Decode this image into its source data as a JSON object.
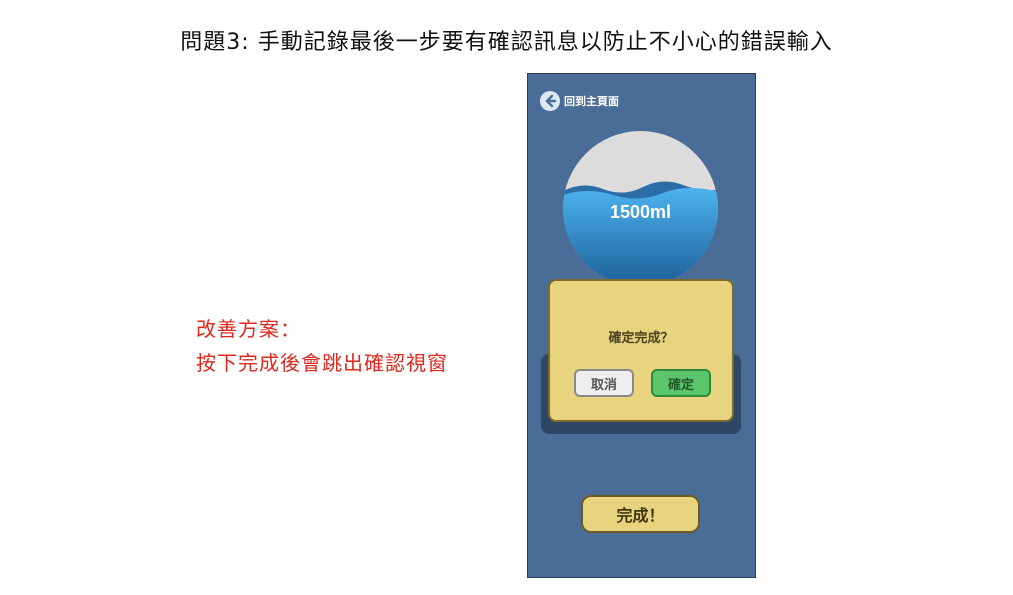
{
  "slide": {
    "title": "問題3: 手動記錄最後一步要有確認訊息以防止不小心的錯誤輸入",
    "improvement_heading": "改善方案：",
    "improvement_text": "按下完成後會跳出確認視窗"
  },
  "app": {
    "back_label": "回到主頁面",
    "water_amount": "1500ml",
    "dialog_message": "確定完成？",
    "cancel_label": "取消",
    "confirm_label": "確定",
    "done_label": "完成！"
  },
  "colors": {
    "screen_bg": "#4a6d98",
    "dialog_bg": "#e8d37f",
    "confirm_green": "#5bc66b",
    "annotation_red": "#e0281e"
  }
}
